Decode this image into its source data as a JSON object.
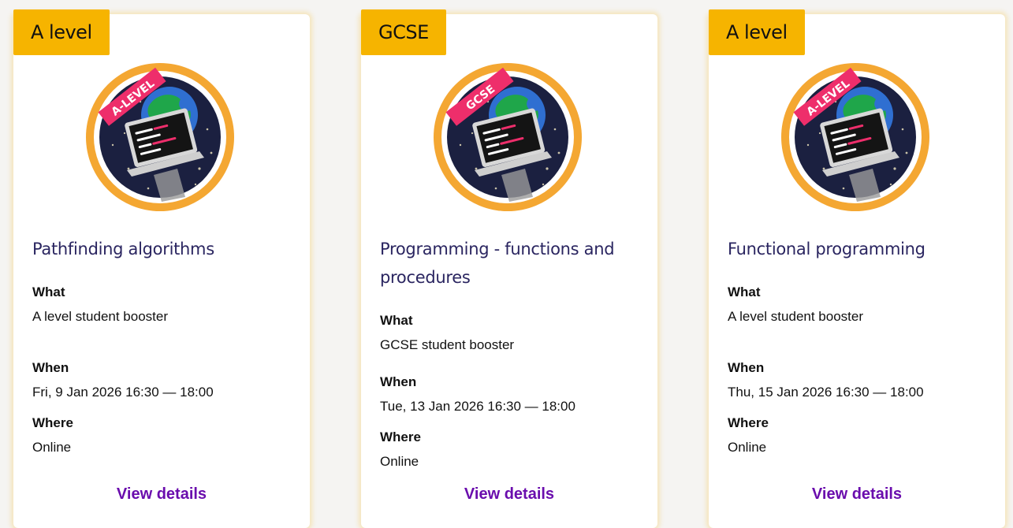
{
  "colors": {
    "badge": "#f6b400",
    "title": "#2a2560",
    "link": "#6a0dad",
    "ring": "#f4a732",
    "ribbon": "#ee2e6b"
  },
  "cards": [
    {
      "badge": "A level",
      "emblem_ribbon": "A-LEVEL",
      "title": "Pathfinding algorithms",
      "what_label": "What",
      "what": "A level student booster",
      "when_label": "When",
      "when": "Fri, 9 Jan 2026 16:30 — 18:00",
      "where_label": "Where",
      "where": "Online",
      "link": "View details"
    },
    {
      "badge": "GCSE",
      "emblem_ribbon": "GCSE",
      "title": "Programming - functions and procedures",
      "what_label": "What",
      "what": "GCSE student booster",
      "when_label": "When",
      "when": "Tue, 13 Jan 2026 16:30 — 18:00",
      "where_label": "Where",
      "where": "Online",
      "link": "View details"
    },
    {
      "badge": "A level",
      "emblem_ribbon": "A-LEVEL",
      "title": "Functional programming",
      "what_label": "What",
      "what": "A level student booster",
      "when_label": "When",
      "when": "Thu, 15 Jan 2026 16:30 — 18:00",
      "where_label": "Where",
      "where": "Online",
      "link": "View details"
    }
  ]
}
